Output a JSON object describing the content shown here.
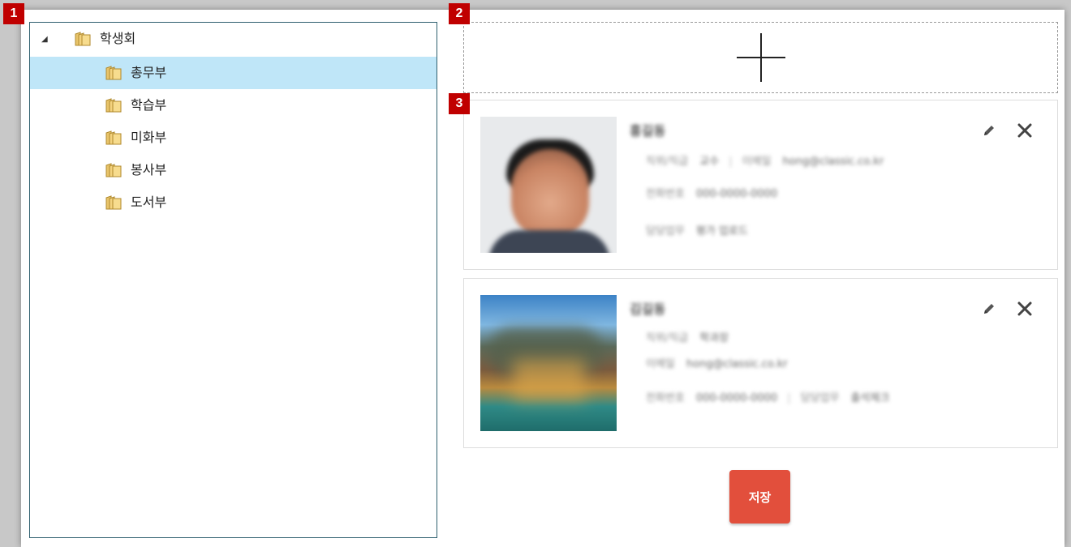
{
  "badges": [
    "1",
    "2",
    "3"
  ],
  "tree": {
    "root": {
      "label": "학생회",
      "expander": "◢"
    },
    "children": [
      {
        "label": "총무부",
        "selected": true
      },
      {
        "label": "학습부",
        "selected": false
      },
      {
        "label": "미화부",
        "selected": false
      },
      {
        "label": "봉사부",
        "selected": false
      },
      {
        "label": "도서부",
        "selected": false
      }
    ]
  },
  "add_zone": {
    "icon": "plus-icon"
  },
  "cards": [
    {
      "photo": "person-photo",
      "name": "홍길동",
      "rows": [
        {
          "label": "직위/직급",
          "value": "교수",
          "label2": "이메일",
          "value2": "hong@classic.co.kr"
        },
        {
          "label": "전화번호",
          "value": "000-0000-0000"
        },
        {
          "label": "담당업무",
          "value": "평가 업로드"
        }
      ]
    },
    {
      "photo": "landscape-photo",
      "name": "김길동",
      "rows": [
        {
          "label": "직위/직급",
          "value": "학과장"
        },
        {
          "label": "이메일",
          "value": "hong@classic.co.kr"
        },
        {
          "label": "전화번호",
          "value": "000-0000-0000",
          "label2": "담당업무",
          "value2": "출석체크"
        }
      ]
    }
  ],
  "actions": {
    "save_label": "저장"
  },
  "colors": {
    "badge": "#c00000",
    "selected_row": "#bfe6f8",
    "save_button": "#e24f3c",
    "tree_border": "#2f5f6f"
  }
}
